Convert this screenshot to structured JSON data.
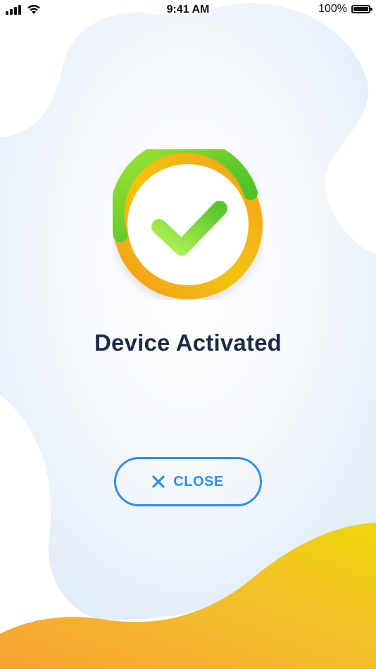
{
  "status_bar": {
    "time": "9:41 AM",
    "battery_text": "100%"
  },
  "main": {
    "title": "Device Activated",
    "close_button_label": "CLOSE"
  },
  "icons": {
    "success": "check-circle-icon",
    "close": "close-x-icon",
    "signal": "cellular-signal-icon",
    "wifi": "wifi-icon",
    "battery": "battery-icon"
  },
  "colors": {
    "title": "#1c2b44",
    "accent_blue": "#2f8ef0",
    "check_green": "#6fcf2a",
    "ring_orange": "#f6a11a",
    "ring_yellow": "#f2d30b",
    "blob_blue": "#eaf2fb"
  }
}
